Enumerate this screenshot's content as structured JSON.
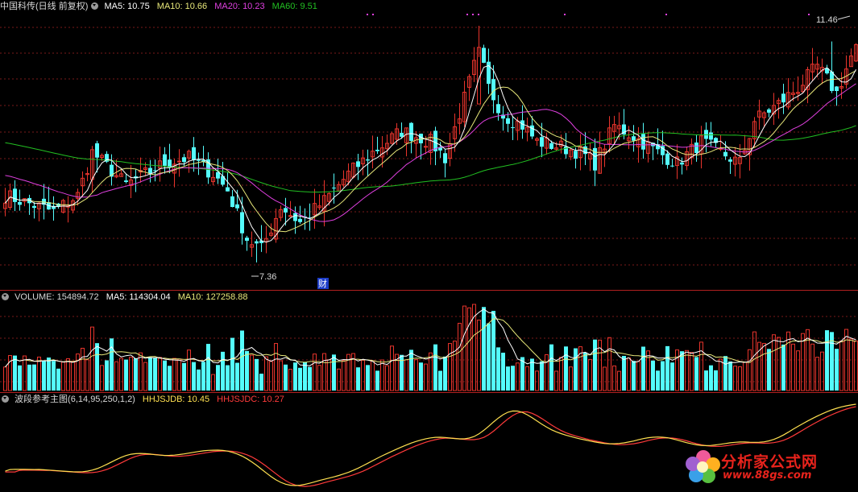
{
  "main": {
    "stock": "中国科传(日线 前复权)",
    "ma5": "MA5: 10.75",
    "ma10": "MA10: 10.66",
    "ma20": "MA20: 10.23",
    "ma60": "MA60: 9.51",
    "high_label": "11.46",
    "low_label": "7.36",
    "marker": "财"
  },
  "volume": {
    "vol": "VOLUME: 154894.72",
    "ma5": "MA5: 114304.04",
    "ma10": "MA10: 127258.88"
  },
  "indicator": {
    "name": "波段参考主图(6,14,95,250,1,2)",
    "hhjsjdb": "HHJSJDB: 10.45",
    "hhjsjdc": "HHJSJDC: 10.27"
  },
  "watermark": {
    "text": "分析家公式网",
    "url": "www.88gs.com"
  },
  "colors": {
    "up": "#e8342c",
    "down": "#54fcfc",
    "ma5": "#ffffff",
    "ma10": "#e8e87a",
    "ma20": "#e040e0",
    "ma60": "#22c022",
    "ind_b": "#ffe050",
    "ind_c": "#ff3a3a"
  },
  "chart_data": [
    {
      "type": "candlestick",
      "title": "中国科传(日线 前复权)",
      "price_range": [
        7.0,
        11.9
      ],
      "series": [
        {
          "name": "MA5",
          "last": 10.75
        },
        {
          "name": "MA10",
          "last": 10.66
        },
        {
          "name": "MA20",
          "last": 10.23
        },
        {
          "name": "MA60",
          "last": 9.51
        }
      ],
      "annotations": [
        {
          "label": "11.46",
          "kind": "period-high",
          "value": 11.46
        },
        {
          "label": "7.36",
          "kind": "period-low",
          "value": 7.36
        }
      ],
      "anchors": [
        {
          "i": 0,
          "c": 8.6
        },
        {
          "i": 10,
          "c": 8.3
        },
        {
          "i": 15,
          "c": 8.6
        },
        {
          "i": 18,
          "c": 9.4
        },
        {
          "i": 25,
          "c": 8.8
        },
        {
          "i": 33,
          "c": 9.2
        },
        {
          "i": 38,
          "c": 9.3
        },
        {
          "i": 43,
          "c": 9.0
        },
        {
          "i": 46,
          "c": 8.7
        },
        {
          "i": 50,
          "c": 7.8
        },
        {
          "i": 53,
          "c": 7.6
        },
        {
          "i": 57,
          "c": 8.4
        },
        {
          "i": 61,
          "c": 8.1
        },
        {
          "i": 66,
          "c": 8.5
        },
        {
          "i": 71,
          "c": 9.0
        },
        {
          "i": 76,
          "c": 9.4
        },
        {
          "i": 82,
          "c": 9.8
        },
        {
          "i": 88,
          "c": 9.6
        },
        {
          "i": 91,
          "c": 9.3
        },
        {
          "i": 95,
          "c": 10.4
        },
        {
          "i": 98,
          "c": 11.3
        },
        {
          "i": 100,
          "c": 10.6
        },
        {
          "i": 103,
          "c": 10.1
        },
        {
          "i": 107,
          "c": 9.9
        },
        {
          "i": 110,
          "c": 9.6
        },
        {
          "i": 115,
          "c": 9.5
        },
        {
          "i": 119,
          "c": 9.4
        },
        {
          "i": 122,
          "c": 9.2
        },
        {
          "i": 126,
          "c": 9.9
        },
        {
          "i": 130,
          "c": 9.7
        },
        {
          "i": 135,
          "c": 9.4
        },
        {
          "i": 139,
          "c": 9.2
        },
        {
          "i": 144,
          "c": 9.6
        },
        {
          "i": 148,
          "c": 9.4
        },
        {
          "i": 152,
          "c": 9.2
        },
        {
          "i": 155,
          "c": 10.0
        },
        {
          "i": 160,
          "c": 10.3
        },
        {
          "i": 164,
          "c": 10.6
        },
        {
          "i": 168,
          "c": 11.0
        },
        {
          "i": 172,
          "c": 10.5
        },
        {
          "i": 176,
          "c": 11.4
        }
      ],
      "count": 177
    },
    {
      "type": "bar",
      "title": "VOLUME",
      "series": [
        {
          "name": "VOLUME",
          "last": 154894.72
        },
        {
          "name": "MA5",
          "last": 114304.04
        },
        {
          "name": "MA10",
          "last": 127258.88
        }
      ]
    },
    {
      "type": "line",
      "title": "波段参考主图(6,14,95,250,1,2)",
      "series": [
        {
          "name": "HHJSJDB",
          "last": 10.45
        },
        {
          "name": "HHJSJDC",
          "last": 10.27
        }
      ]
    }
  ]
}
